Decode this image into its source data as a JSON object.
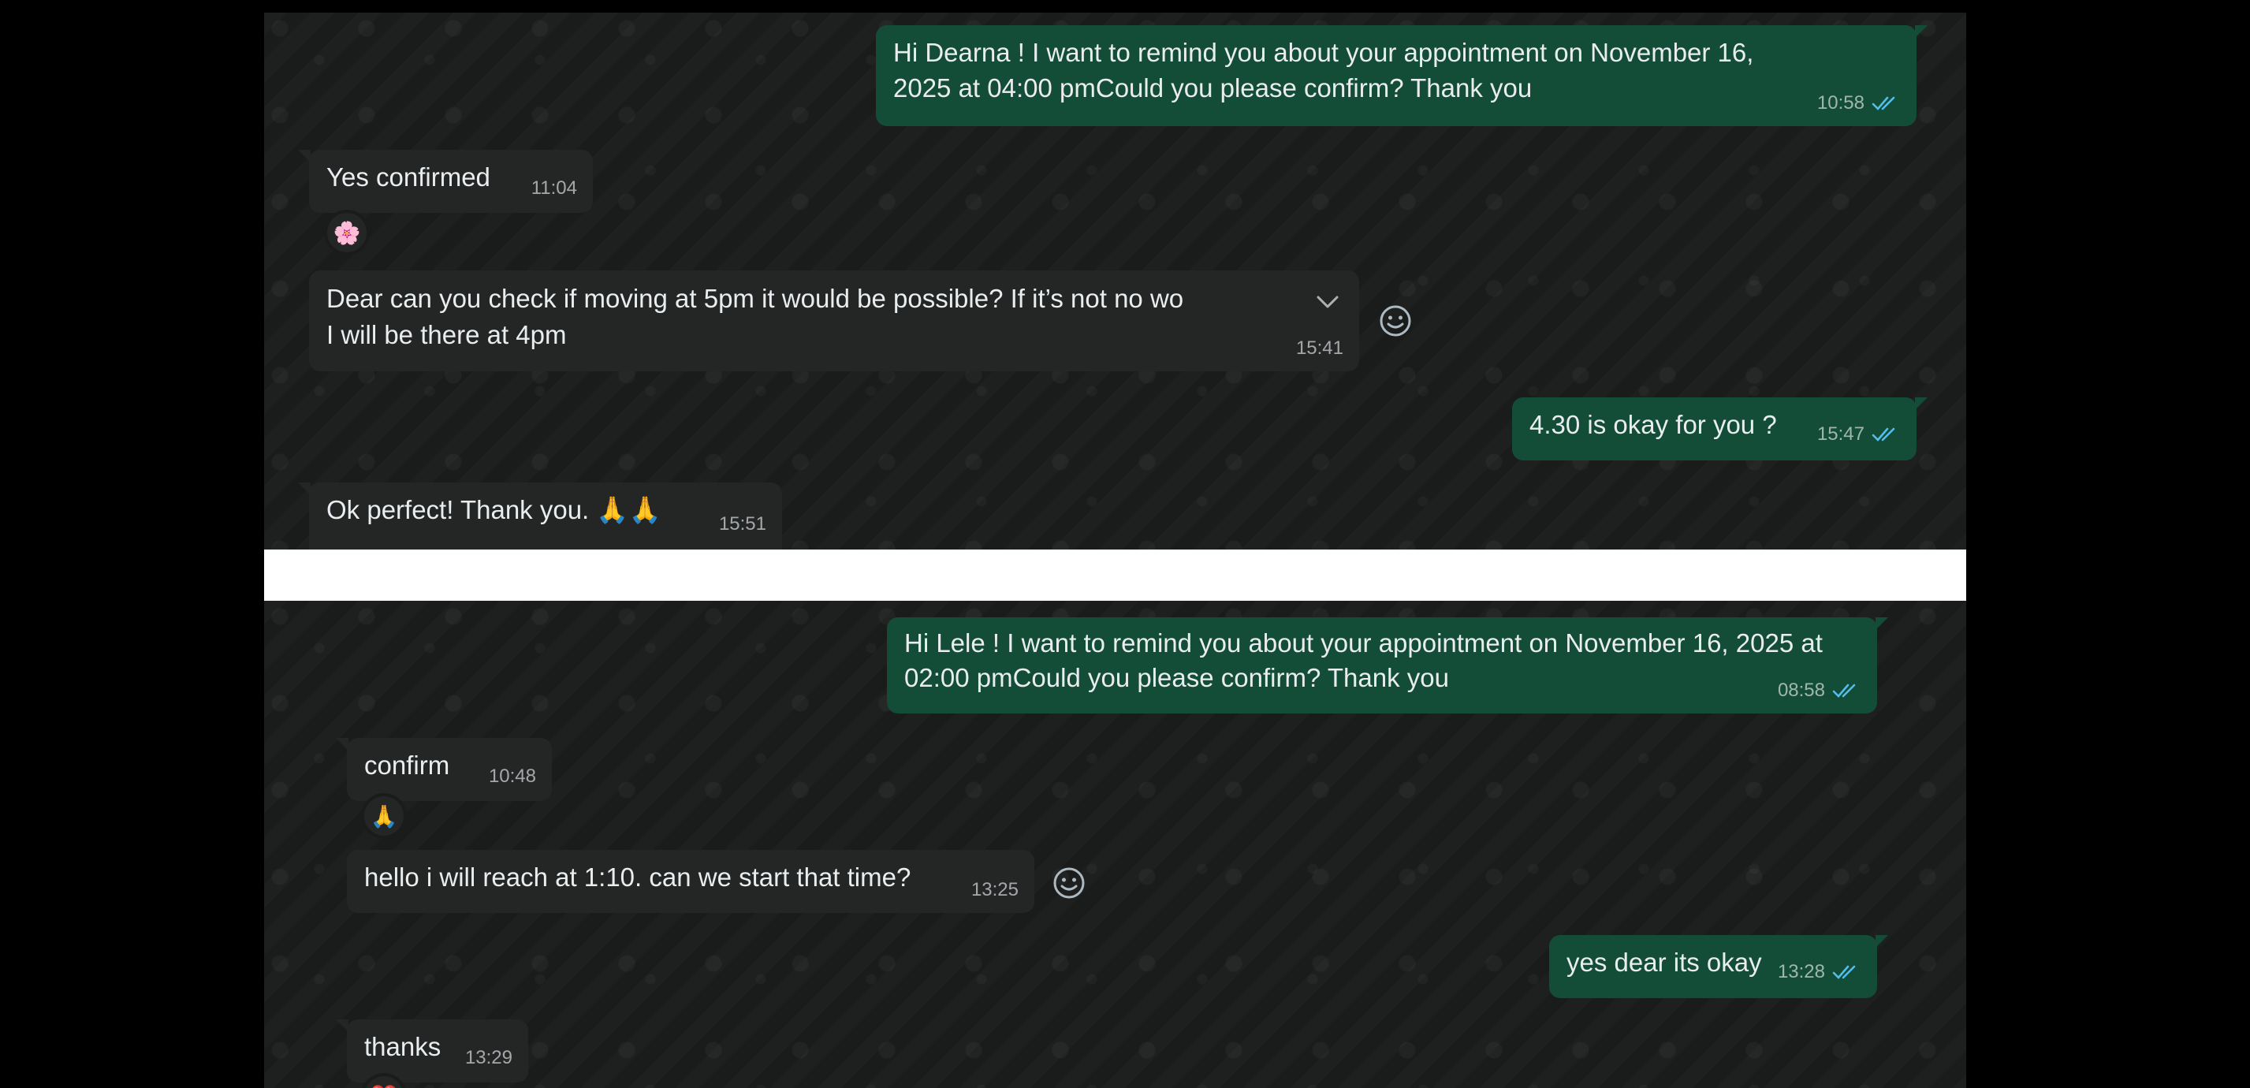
{
  "conversations": [
    {
      "messages": [
        {
          "direction": "out",
          "text_line1": "Hi Dearna ! I want to remind you about your appointment on November 16,",
          "text_line2": "2025 at 04:00 pmCould you please confirm? Thank you",
          "time": "10:58",
          "status": "read"
        },
        {
          "direction": "in",
          "text": "Yes confirmed",
          "time": "11:04",
          "reaction": "🌸"
        },
        {
          "direction": "in",
          "text_line1": "Dear can you check if moving at 5pm it would be possible? If it’s not no wo",
          "text_line2": "I will be there at 4pm",
          "time": "15:41"
        },
        {
          "direction": "out",
          "text": "4.30 is okay for you ?",
          "time": "15:47",
          "status": "read"
        },
        {
          "direction": "in",
          "text": "Ok perfect! Thank you. 🙏🙏",
          "time": "15:51"
        }
      ]
    },
    {
      "messages": [
        {
          "direction": "out",
          "text_line1": "Hi Lele ! I want to remind you about your appointment on November 16, 2025 at",
          "text_line2": "02:00 pmCould you please confirm? Thank you",
          "time": "08:58",
          "status": "read"
        },
        {
          "direction": "in",
          "text": "confirm",
          "time": "10:48",
          "reaction": "🙏"
        },
        {
          "direction": "in",
          "text": "hello i will reach at 1:10. can we start that time?",
          "time": "13:25"
        },
        {
          "direction": "out",
          "text": "yes dear its okay",
          "time": "13:28",
          "status": "read"
        },
        {
          "direction": "in",
          "text": "thanks",
          "time": "13:29",
          "reaction": "❤️"
        }
      ]
    }
  ],
  "icons": {
    "read_ticks": "double-check-icon",
    "emoji_button": "smiley-icon",
    "menu_chevron": "chevron-down-icon"
  },
  "colors": {
    "outgoing_bubble": "#144d37",
    "incoming_bubble": "#242626",
    "chat_background": "#1a1b1b",
    "read_ticks": "#53bdeb"
  }
}
